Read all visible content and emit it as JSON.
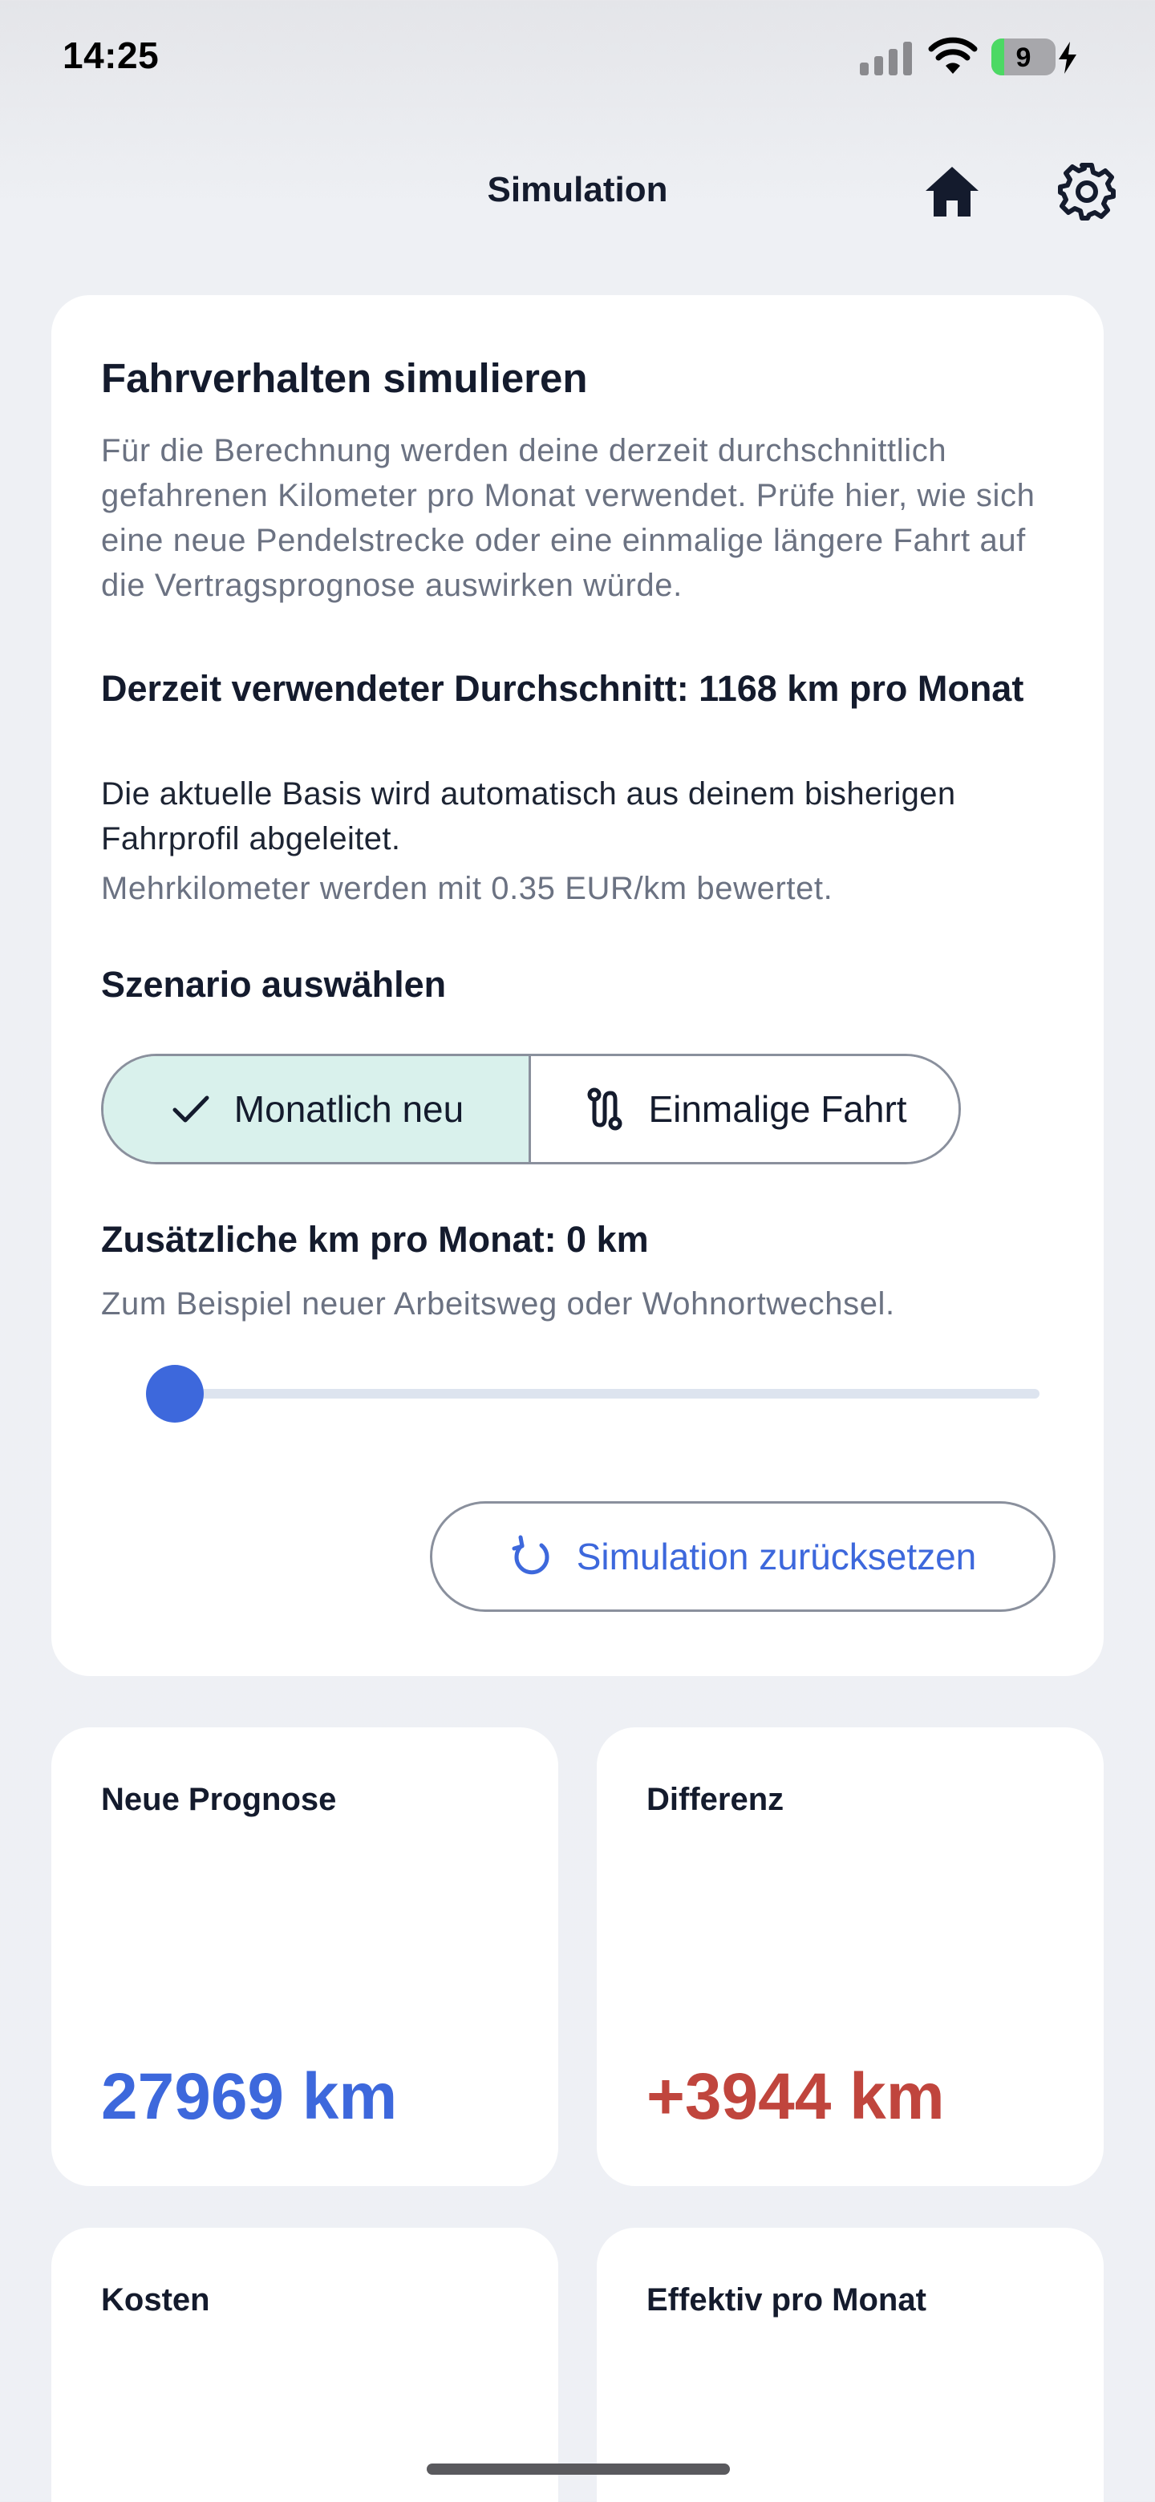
{
  "status_bar": {
    "time": "14:25",
    "battery": "9"
  },
  "header": {
    "title": "Simulation",
    "icons": [
      "home-icon",
      "gear-icon"
    ]
  },
  "main_card": {
    "title": "Fahrverhalten simulieren",
    "description": "Für die Berechnung werden deine derzeit durchschnittlich gefahrenen Kilometer pro Monat verwendet. Prüfe hier, wie sich eine neue Pendelstrecke oder eine einmalige längere Fahrt auf die Vertragsprognose auswirken würde.",
    "average_label": "Derzeit verwendeter Durchschnitt: 1168 km pro Monat",
    "average_sub": "Die aktuelle Basis wird automatisch aus deinem bisherigen Fahrprofil abgeleitet.",
    "rate_note": "Mehrkilometer werden mit 0.35 EUR/km bewertet.",
    "scenario_title": "Szenario auswählen",
    "scenarios": [
      {
        "label": "Monatlich neu",
        "selected": true,
        "icon": "check-icon"
      },
      {
        "label": "Einmalige Fahrt",
        "selected": false,
        "icon": "route-icon"
      }
    ],
    "km_title": "Zusätzliche km pro Monat: 0 km",
    "km_sub": "Zum Beispiel neuer Arbeitsweg oder Wohnortwechsel.",
    "slider_value": 0,
    "reset_label": "Simulation zurücksetzen"
  },
  "stats": [
    {
      "label": "Neue Prognose",
      "value": "27969 km",
      "color": "#3d68dc"
    },
    {
      "label": "Differenz",
      "value": "+3944 km",
      "color": "#c0453d"
    },
    {
      "label": "Kosten",
      "value": ""
    },
    {
      "label": "Effektiv pro Monat",
      "value": ""
    }
  ],
  "colors": {
    "accent": "#3d68dc",
    "selected_bg": "#d9f1ec",
    "negative": "#c0453d"
  }
}
